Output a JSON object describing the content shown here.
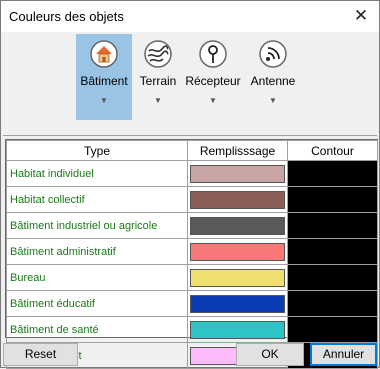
{
  "window": {
    "title": "Couleurs des objets",
    "close_glyph": "✕"
  },
  "ribbon": {
    "items": [
      {
        "label": "Bâtiment",
        "icon": "building-icon",
        "active": true
      },
      {
        "label": "Terrain",
        "icon": "terrain-icon",
        "active": false
      },
      {
        "label": "Récepteur",
        "icon": "receiver-icon",
        "active": false
      },
      {
        "label": "Antenne",
        "icon": "antenna-icon",
        "active": false
      }
    ],
    "dropdown_glyph": "▼"
  },
  "table": {
    "headers": [
      "Type",
      "Remplisssage",
      "Contour"
    ],
    "rows": [
      {
        "type": "Habitat individuel",
        "fill": "#c8a4a4",
        "contour": "#000000"
      },
      {
        "type": "Habitat collectif",
        "fill": "#8c5c58",
        "contour": "#000000"
      },
      {
        "type": "Bâtiment industriel ou agricole",
        "fill": "#5a5a5a",
        "contour": "#000000"
      },
      {
        "type": "Bâtiment administratif",
        "fill": "#f87878",
        "contour": "#000000"
      },
      {
        "type": "Bureau",
        "fill": "#f0e070",
        "contour": "#000000"
      },
      {
        "type": "Bâtiment éducatif",
        "fill": "#0a3cb4",
        "contour": "#000000"
      },
      {
        "type": "Bâtiment de santé",
        "fill": "#2cc4c4",
        "contour": "#000000"
      },
      {
        "type": "Autre bâtiment",
        "fill": "#fcbcfc",
        "contour": "#000000"
      }
    ]
  },
  "buttons": {
    "reset": "Reset",
    "ok": "OK",
    "cancel": "Annuler"
  }
}
